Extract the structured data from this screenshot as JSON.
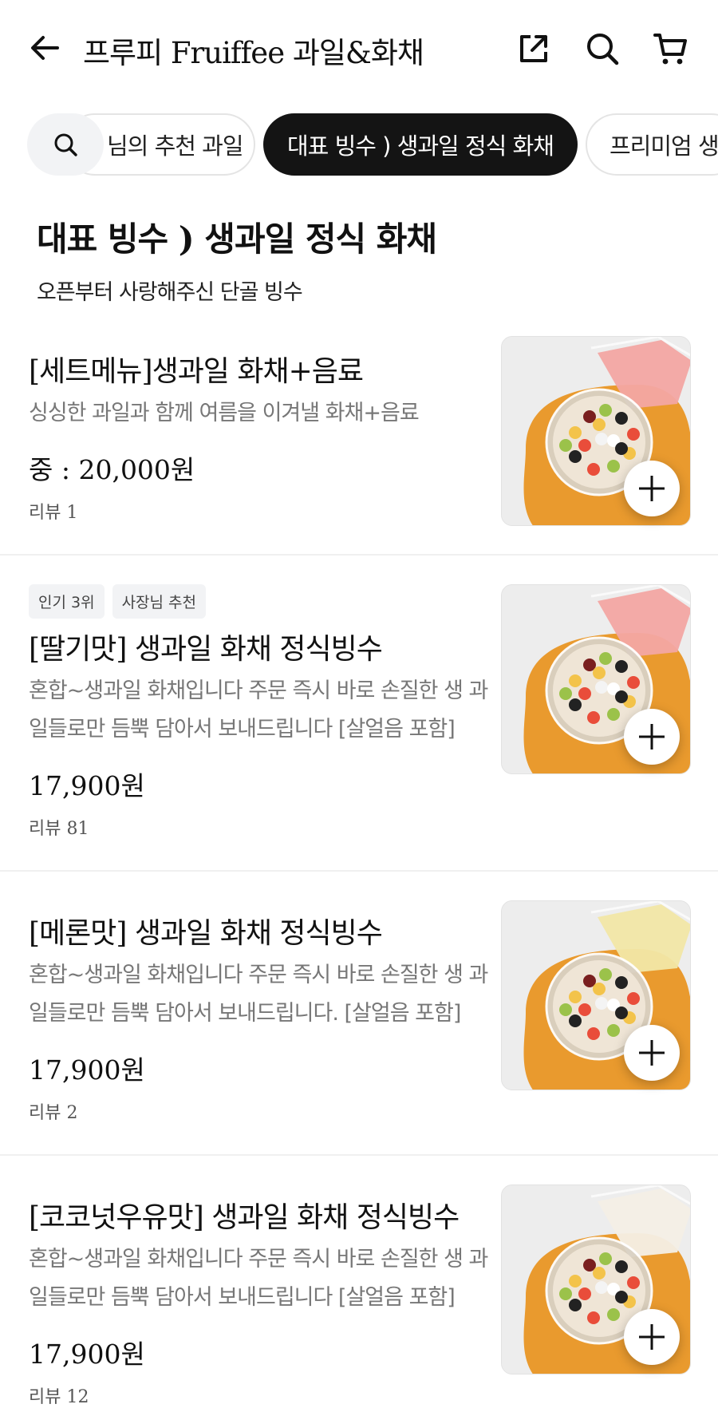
{
  "header": {
    "title": "프루피 Fruiffee 과일&화채"
  },
  "categories": {
    "chips": [
      {
        "label": "사장님의 추천 과일",
        "visible_text": "님의 추천 과일",
        "selected": false
      },
      {
        "label": "대표 빙수 ) 생과일 정식 화채",
        "visible_text": "대표 빙수 ) 생과일 정식 화채",
        "selected": true
      },
      {
        "label": "프리미엄 생",
        "visible_text": "프리미엄 생",
        "selected": false
      }
    ]
  },
  "section": {
    "title": "대표 빙수 ) 생과일 정식 화채",
    "subtitle": "오픈부터 사랑해주신 단골 빙수"
  },
  "items": [
    {
      "name": "[세트메뉴]생과일 화채+음료",
      "description": "싱싱한 과일과 함께 여름을 이겨낼 화채+음료",
      "price": "중 : 20,000원",
      "review": "리뷰 1",
      "badges": [],
      "drink_color": "#f3a6a3"
    },
    {
      "name": "[딸기맛] 생과일 화채 정식빙수",
      "description": "혼합~생과일  화채입니다  주문 즉시 바로 손질한 생 과일들로만 듬뿍 담아서 보내드립니다  [살얼음 포함]",
      "price": "17,900원",
      "review": "리뷰 81",
      "badges": [
        "인기 3위",
        "사장님 추천"
      ],
      "drink_color": "#f3a6a3"
    },
    {
      "name": "[메론맛] 생과일 화채 정식빙수",
      "description": "혼합~생과일 화채입니다 주문 즉시 바로 손질한 생 과일들로만 듬뿍 담아서 보내드립니다. [살얼음 포함]",
      "price": "17,900원",
      "review": "리뷰 2",
      "badges": [],
      "drink_color": "#f2e7a6"
    },
    {
      "name": "[코코넛우유맛] 생과일 화채 정식빙수",
      "description": "혼합~생과일 화채입니다 주문 즉시 바로 손질한 생 과일들로만 듬뿍 담아서 보내드립니다 [살얼음 포함]",
      "price": "17,900원",
      "review": "리뷰 12",
      "badges": [],
      "drink_color": "#f4efe6"
    }
  ],
  "colors": {
    "selected_chip": "#141414",
    "plate_orange": "#e99a2e",
    "thumb_bg": "#ececec"
  },
  "icons": [
    "back-arrow-icon",
    "share-icon",
    "search-icon",
    "cart-icon",
    "plus-icon"
  ]
}
